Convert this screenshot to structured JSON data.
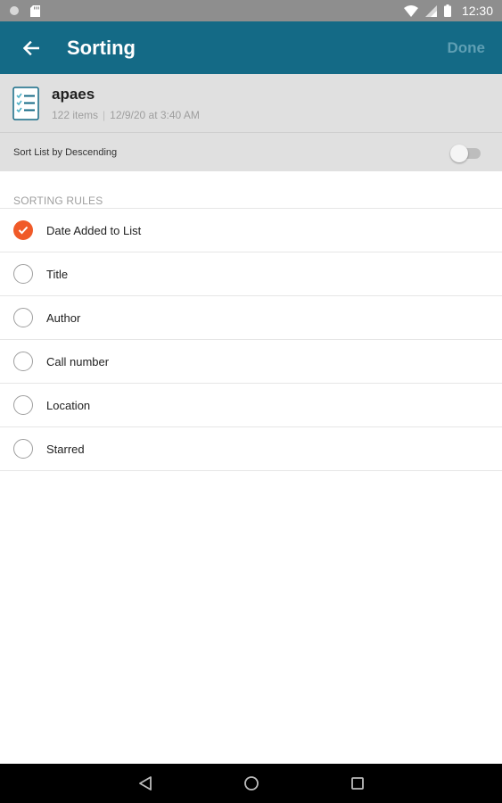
{
  "status_bar": {
    "time": "12:30",
    "icons": [
      "notification-dot-icon",
      "sd-card-icon",
      "wifi-icon",
      "signal-icon",
      "battery-icon"
    ]
  },
  "app_bar": {
    "title": "Sorting",
    "done_label": "Done",
    "background_color": "#146a86",
    "back_icon": "arrow-back-icon"
  },
  "list": {
    "name": "apaes",
    "item_count": "122 items",
    "separator": "|",
    "date": "12/9/20 at 3:40 AM",
    "icon": "checklist-icon"
  },
  "sort_descending": {
    "label": "Sort List by Descending",
    "enabled": false
  },
  "sorting_rules": {
    "section_title": "SORTING RULES",
    "accent_color": "#f05a28",
    "options": [
      {
        "label": "Date Added to List",
        "selected": true
      },
      {
        "label": "Title",
        "selected": false
      },
      {
        "label": "Author",
        "selected": false
      },
      {
        "label": "Call number",
        "selected": false
      },
      {
        "label": "Location",
        "selected": false
      },
      {
        "label": "Starred",
        "selected": false
      }
    ]
  },
  "nav_bar": {
    "icons": [
      "back-triangle-icon",
      "home-circle-icon",
      "recents-square-icon"
    ]
  }
}
